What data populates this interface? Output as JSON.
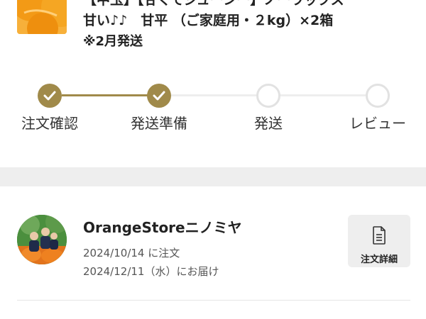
{
  "product": {
    "title_line1": "【中玉】【甘くてジューシー】ノーワックス",
    "title_line2": "甘い♪♪　甘平 （ご家庭用・２kg）×2箱",
    "note": "※2月発送"
  },
  "stepper": {
    "steps": [
      {
        "label": "注文確認",
        "status": "done"
      },
      {
        "label": "発送準備",
        "status": "done"
      },
      {
        "label": "発送",
        "status": "todo"
      },
      {
        "label": "レビュー",
        "status": "todo"
      }
    ]
  },
  "order": {
    "shop_name": "OrangeStoreニノミヤ",
    "order_date": "2024/10/14 に注文",
    "delivery_date": "2024/12/11（水）にお届け",
    "detail_button_label": "注文詳細"
  },
  "colors": {
    "accent": "#a08a4a",
    "inactive": "#e2e2e2",
    "band": "#eeeeee"
  }
}
